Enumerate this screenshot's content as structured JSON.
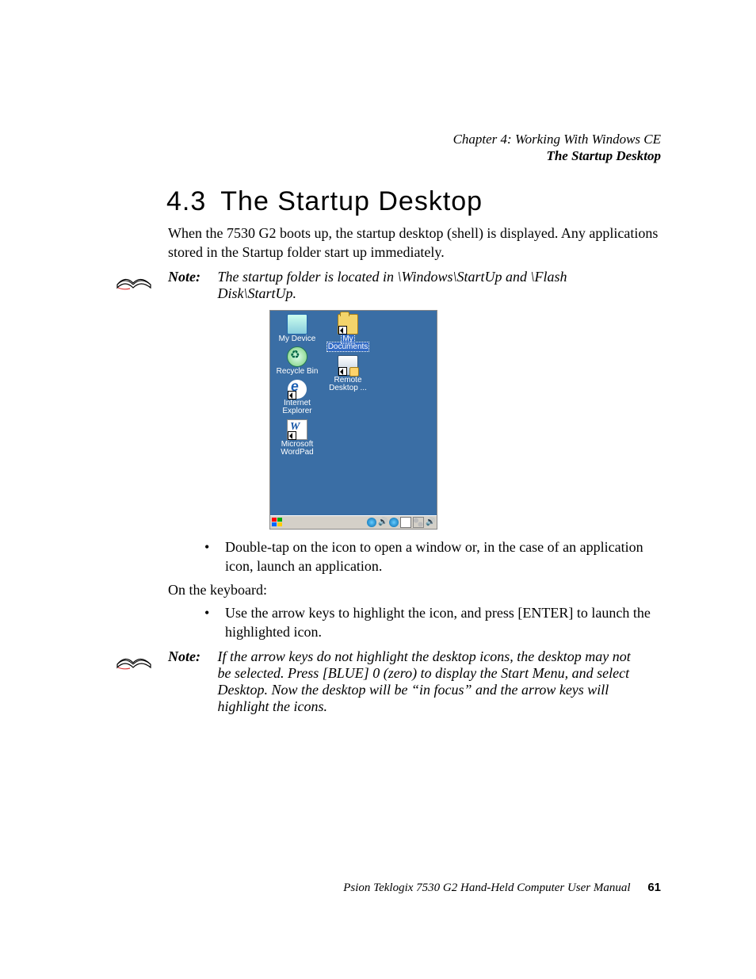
{
  "runhead": {
    "line1": "Chapter 4: Working With Windows CE",
    "line2": "The Startup Desktop"
  },
  "section": {
    "number": "4.3",
    "title": "The Startup Desktop"
  },
  "intro": "When the 7530 G2 boots up, the startup desktop (shell) is displayed. Any applications stored in the Startup folder start up immediately.",
  "note1": {
    "label": "Note:",
    "text": "The startup folder is located in \\Windows\\StartUp and \\Flash Disk\\StartUp."
  },
  "desktop": {
    "icons_col1": [
      {
        "name": "my-device",
        "label": "My Device"
      },
      {
        "name": "recycle-bin",
        "label": "Recycle Bin"
      },
      {
        "name": "internet-explorer",
        "label_lines": [
          "Internet",
          "Explorer"
        ]
      },
      {
        "name": "microsoft-wordpad",
        "label_lines": [
          "Microsoft",
          "WordPad"
        ]
      }
    ],
    "icons_col2": [
      {
        "name": "my-documents",
        "label_lines": [
          "My",
          "Documents"
        ],
        "selected": true
      },
      {
        "name": "remote-desktop",
        "label_lines": [
          "Remote",
          "Desktop ..."
        ]
      }
    ]
  },
  "bullet1": "Double-tap on the icon to open a window or, in the case of an application icon, launch an application.",
  "kb_header": "On the keyboard:",
  "bullet2": "Use the arrow keys to highlight the icon, and press [ENTER] to launch the highlighted icon.",
  "note2": {
    "label": "Note:",
    "text": "If the arrow keys do not highlight the desktop icons, the desktop may not be selected. Press [BLUE] 0 (zero) to display the Start Menu, and select Desktop. Now the desktop will be “in focus” and the arrow keys will highlight the icons."
  },
  "footer": {
    "text": "Psion Teklogix 7530 G2 Hand-Held Computer User Manual",
    "page": "61"
  }
}
